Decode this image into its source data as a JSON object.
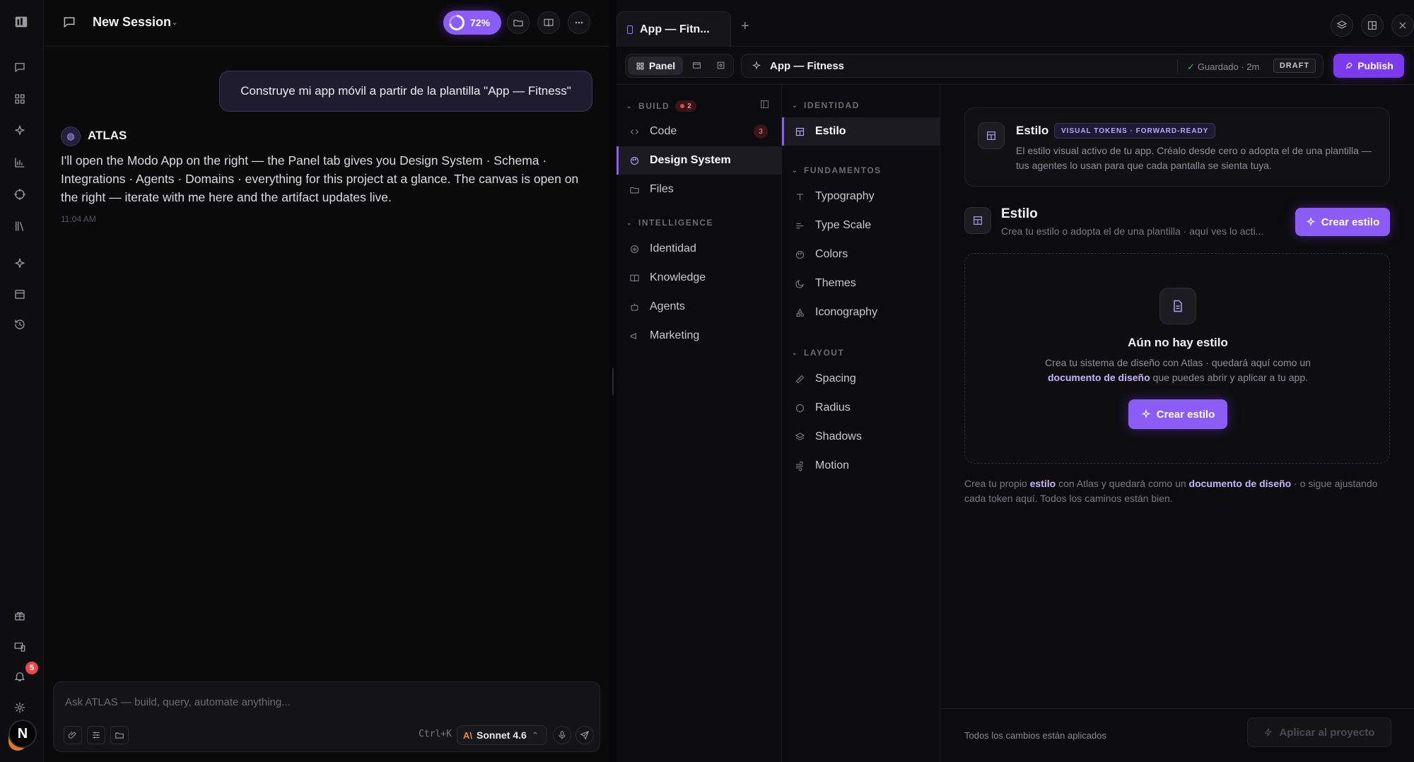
{
  "session": {
    "title": "New Session",
    "progress": "72%"
  },
  "chat": {
    "user_message": "Construye mi app móvil a partir de la plantilla \"App — Fitness\"",
    "assistant_name": "ATLAS",
    "assistant_message": "I'll open the Modo App on the right — the Panel tab gives you Design System · Schema · Integrations · Agents · Domains · everything for this project at a glance. The canvas is open on the right — iterate with me here and the artifact updates live.",
    "timestamp": "11:04 AM"
  },
  "composer": {
    "placeholder": "Ask ATLAS — build, query, automate anything...",
    "shortcut": "Ctrl+K",
    "model": "Sonnet 4.6",
    "model_logo": "A\\"
  },
  "rail": {
    "notifications": "5",
    "avatar_initial": "N"
  },
  "panel": {
    "tab_label": "App — Fitn...",
    "view_label": "Panel",
    "breadcrumb": "App — Fitness",
    "saved": "Guardado · 2m",
    "status": "DRAFT",
    "publish": "Publish"
  },
  "nav1": {
    "build": {
      "label": "BUILD",
      "badge": "2"
    },
    "items_build": [
      {
        "label": "Code",
        "count": "3"
      },
      {
        "label": "Design System"
      },
      {
        "label": "Files"
      }
    ],
    "intelligence": {
      "label": "INTELLIGENCE"
    },
    "items_intel": [
      {
        "label": "Identidad"
      },
      {
        "label": "Knowledge"
      },
      {
        "label": "Agents"
      },
      {
        "label": "Marketing"
      }
    ]
  },
  "nav2": {
    "identidad": "IDENTIDAD",
    "estilo": "Estilo",
    "fundamentos": "FUNDAMENTOS",
    "items_fund": [
      "Typography",
      "Type Scale",
      "Colors",
      "Themes",
      "Iconography"
    ],
    "layout": "LAYOUT",
    "items_layout": [
      "Spacing",
      "Radius",
      "Shadows",
      "Motion"
    ]
  },
  "main": {
    "hero_title": "Estilo",
    "hero_badge": "VISUAL TOKENS · FORWARD-READY",
    "hero_desc": "El estilo visual activo de tu app. Créalo desde cero o adopta el de una plantilla — tus agentes lo usan para que cada pantalla se sienta tuya.",
    "section_title": "Estilo",
    "section_desc": "Crea tu estilo o adopta el de una plantilla · aquí ves lo acti...",
    "create_btn": "Crear estilo",
    "empty_title": "Aún no hay estilo",
    "empty_desc_a": "Crea tu sistema de diseño con Atlas · quedará aquí como un",
    "empty_desc_link": "documento de diseño",
    "empty_desc_b": "que puedes abrir y aplicar a tu app.",
    "empty_btn": "Crear estilo",
    "foot_a": "Crea tu propio",
    "foot_link1": "estilo",
    "foot_b": "con Atlas y quedará como un",
    "foot_link2": "documento de diseño",
    "foot_c": "· o sigue ajustando cada token aquí. Todos los caminos están bien.",
    "status_text": "Todos los cambios están aplicados",
    "apply_btn": "Aplicar al proyecto"
  }
}
